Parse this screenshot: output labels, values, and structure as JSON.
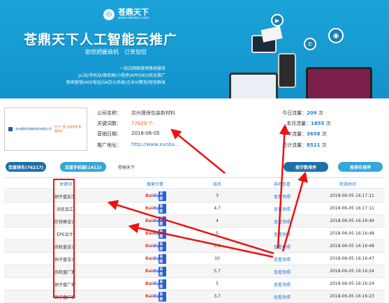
{
  "banner": {
    "logo_name": "苍鼎天下",
    "logo_url": "www.saicdsn.com",
    "title": "苍鼎天下人工智能云推广",
    "subtitle": "助您把握商机　订单加倍",
    "lines": [
      "一站式网络营销落地服务",
      "pc站/手机站/微官网/小程序/APP/SEO优化推广",
      "新闻营销/400电话/OA办公系统/企业VI策划/短信群发"
    ]
  },
  "company": {
    "logo_text": "苏州晟保包装新材料有限公司",
    "logo_tagline": "生产厂家 全国直销 质量保证"
  },
  "info": {
    "name_label": "公司名称：",
    "name_value": "苏州晟保包装新材料",
    "keywords_label": "关键词数：",
    "keywords_value": "77629 个",
    "date_label": "营销日期：",
    "date_value": "2018-06-05",
    "url_label": "推广地址：",
    "url_value": "http://www.xunba..."
  },
  "stats": {
    "today_label": "今日流量：",
    "today_value": "209",
    "month_label": "本月流量：",
    "month_value": "1855",
    "month_prefix": "本",
    "halfyear_label": "半年流量：",
    "halfyear_value": "3658",
    "halfyear_prefix": "",
    "total_label": "总计流量：",
    "total_value": "8521",
    "unit": "次"
  },
  "tabs": {
    "tab1": "百度排名(76217)",
    "tab2": "百度手机端(1412)",
    "tab3": "苍鼎天下",
    "btn_sort": "按字数排序",
    "btn_rank": "按排名排序"
  },
  "table": {
    "headers": [
      "关键词",
      "搜索引擎",
      "排名",
      "排名查看",
      "检测时间"
    ],
    "engine_label_1": "Bai",
    "engine_label_2": "du",
    "engine_label_3": "百度",
    "rows": [
      {
        "keyword": "铜子盘加工",
        "rank": "3",
        "link": "查看快照",
        "time": "2018-06-05 16:17:11"
      },
      {
        "keyword": "齿轮加工",
        "rank": "4,7",
        "link": "查看快照",
        "time": "2018-06-05 16:17:11"
      },
      {
        "keyword": "防铁棒设计",
        "rank": "4",
        "link": "查看快照",
        "time": "2018-06-05 16:16:49"
      },
      {
        "keyword": "EPE设计",
        "rank": "5",
        "link": "查看快照",
        "time": "2018-06-05 16:16:48"
      },
      {
        "keyword": "齿轮盘设计",
        "rank": "5,6",
        "link": "查看快照",
        "time": "2018-06-05 16:16:48"
      },
      {
        "keyword": "铜子盘设计",
        "rank": "10",
        "link": "查看快照",
        "time": "2018-06-05 16:16:47"
      },
      {
        "keyword": "齿轮盘厂家",
        "rank": "5,7",
        "link": "查看快照",
        "time": "2018-06-05 16:16:24"
      },
      {
        "keyword": "铜子盘厂家",
        "rank": "5",
        "link": "查看快照",
        "time": "2018-06-05 16:16:24"
      },
      {
        "keyword": "铜子盘厂家",
        "rank": "3,7",
        "link": "查看快照",
        "time": "2018-06-05 16:16:23"
      }
    ]
  },
  "colors": {
    "banner_blue": "#1493cc",
    "link_blue": "#2a7bcf",
    "annotation_red": "#e11"
  }
}
